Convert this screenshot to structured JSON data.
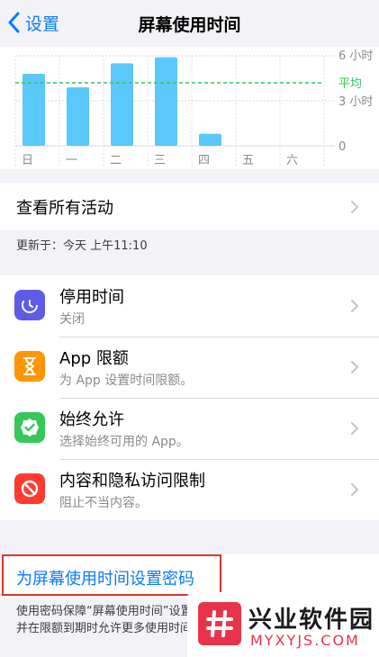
{
  "nav": {
    "back_label": "设置",
    "title": "屏幕使用时间"
  },
  "chart_data": {
    "type": "bar",
    "categories": [
      "日",
      "一",
      "二",
      "三",
      "四",
      "五",
      "六"
    ],
    "values": [
      4.8,
      3.9,
      5.5,
      5.9,
      0.8,
      0,
      0
    ],
    "ylim": [
      0,
      6
    ],
    "y_tick_labels": [
      "6 小时",
      "3 小时",
      "0"
    ],
    "average_label": "平均",
    "average_value": 4.2,
    "bar_color": "#5ac8fa",
    "average_color": "#34c759"
  },
  "activity": {
    "label": "查看所有活动"
  },
  "updated": "更新于：今天 上午11:10",
  "items": [
    {
      "title": "停用时间",
      "subtitle": "关闭",
      "icon": "downtime-icon",
      "color": "#5e5ce6"
    },
    {
      "title": "App 限额",
      "subtitle": "为 App 设置时间限额。",
      "icon": "hourglass-icon",
      "color": "#ff9500"
    },
    {
      "title": "始终允许",
      "subtitle": "选择始终可用的 App。",
      "icon": "checkmark-icon",
      "color": "#34c759"
    },
    {
      "title": "内容和隐私访问限制",
      "subtitle": "阻止不当内容。",
      "icon": "restriction-icon",
      "color": "#ff3b30"
    }
  ],
  "passcode": {
    "link": "为屏幕使用时间设置密码",
    "footnote": "使用密码保障“屏幕使用时间”设置的安全，并在限额到期时允许更多使用时间。"
  },
  "watermark": {
    "name": "兴业软件园",
    "url": "MYXYJS.COM"
  }
}
